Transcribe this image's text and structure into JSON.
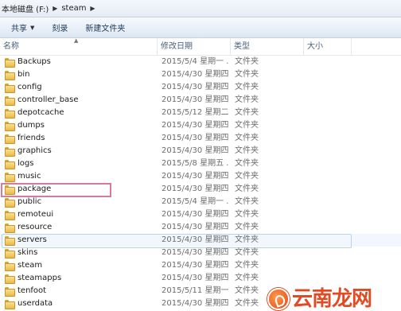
{
  "address_bar": {
    "crumbs": [
      "本地磁盘 (F:)",
      "steam"
    ]
  },
  "toolbar": {
    "share_label": "共享",
    "burn_label": "刻录",
    "new_folder_label": "新建文件夹"
  },
  "columns": {
    "name": "名称",
    "date": "修改日期",
    "type": "类型",
    "size": "大小"
  },
  "files": [
    {
      "name": "Backups",
      "date": "2015/5/4 星期一 ...",
      "type": "文件夹",
      "size": ""
    },
    {
      "name": "bin",
      "date": "2015/4/30 星期四 ...",
      "type": "文件夹",
      "size": ""
    },
    {
      "name": "config",
      "date": "2015/4/30 星期四 ...",
      "type": "文件夹",
      "size": ""
    },
    {
      "name": "controller_base",
      "date": "2015/4/30 星期四 ...",
      "type": "文件夹",
      "size": ""
    },
    {
      "name": "depotcache",
      "date": "2015/5/12 星期二 ...",
      "type": "文件夹",
      "size": ""
    },
    {
      "name": "dumps",
      "date": "2015/4/30 星期四 ...",
      "type": "文件夹",
      "size": ""
    },
    {
      "name": "friends",
      "date": "2015/4/30 星期四 ...",
      "type": "文件夹",
      "size": ""
    },
    {
      "name": "graphics",
      "date": "2015/4/30 星期四 ...",
      "type": "文件夹",
      "size": ""
    },
    {
      "name": "logs",
      "date": "2015/5/8 星期五 ...",
      "type": "文件夹",
      "size": ""
    },
    {
      "name": "music",
      "date": "2015/4/30 星期四 ...",
      "type": "文件夹",
      "size": ""
    },
    {
      "name": "package",
      "date": "2015/4/30 星期四 ...",
      "type": "文件夹",
      "size": ""
    },
    {
      "name": "public",
      "date": "2015/5/4 星期一 ...",
      "type": "文件夹",
      "size": ""
    },
    {
      "name": "remoteui",
      "date": "2015/4/30 星期四 ...",
      "type": "文件夹",
      "size": ""
    },
    {
      "name": "resource",
      "date": "2015/4/30 星期四 ...",
      "type": "文件夹",
      "size": ""
    },
    {
      "name": "servers",
      "date": "2015/4/30 星期四 ...",
      "type": "文件夹",
      "size": ""
    },
    {
      "name": "skins",
      "date": "2015/4/30 星期四 ...",
      "type": "文件夹",
      "size": ""
    },
    {
      "name": "steam",
      "date": "2015/4/30 星期四 ...",
      "type": "文件夹",
      "size": ""
    },
    {
      "name": "steamapps",
      "date": "2015/4/30 星期四 ...",
      "type": "文件夹",
      "size": ""
    },
    {
      "name": "tenfoot",
      "date": "2015/5/11 星期一 ...",
      "type": "文件夹",
      "size": ""
    },
    {
      "name": "userdata",
      "date": "2015/4/30 星期四 ...",
      "type": "文件夹",
      "size": ""
    }
  ],
  "hovered_file": "servers",
  "annotated_file": "package",
  "watermark": {
    "text": "云南龙网",
    "color": "#e04b23"
  },
  "colors": {
    "annotation_border": "#d57aa0",
    "hover_border": "#b8d2ee",
    "folder": "#eab94a"
  }
}
